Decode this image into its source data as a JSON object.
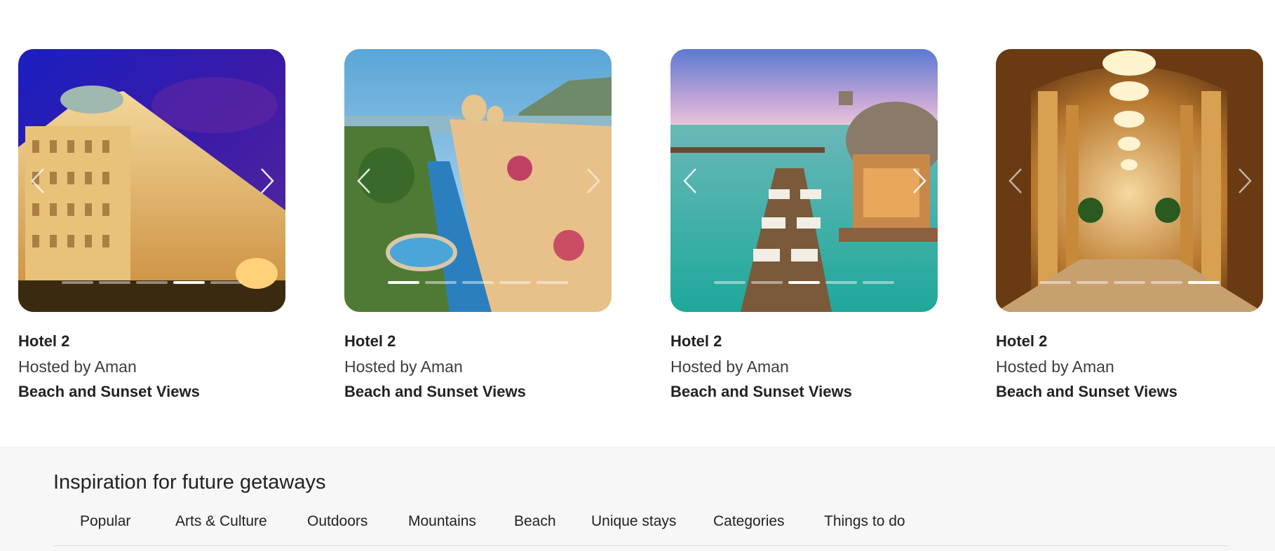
{
  "listings": [
    {
      "title": "Hotel 2",
      "host": "Hosted by Aman",
      "feature": "Beach and Sunset Views",
      "photo": "palace-hotel-night",
      "dots": 5,
      "active_dot": 3
    },
    {
      "title": "Hotel 2",
      "host": "Hosted by Aman",
      "feature": "Beach and Sunset Views",
      "photo": "lake-palace-pool",
      "dots": 5,
      "active_dot": 0
    },
    {
      "title": "Hotel 2",
      "host": "Hosted by Aman",
      "feature": "Beach and Sunset Views",
      "photo": "overwater-villa",
      "dots": 5,
      "active_dot": 2
    },
    {
      "title": "Hotel 2",
      "host": "Hosted by Aman",
      "feature": "Beach and Sunset Views",
      "photo": "chandelier-lobby",
      "dots": 5,
      "active_dot": 4
    }
  ],
  "icons": {
    "prev": "chevron-left-icon",
    "next": "chevron-right-icon"
  },
  "inspiration": {
    "title": "Inspiration for future getaways",
    "tabs": [
      "Popular",
      "Arts & Culture",
      "Outdoors",
      "Mountains",
      "Beach",
      "Unique stays",
      "Categories",
      "Things to do"
    ]
  },
  "colors": {
    "section_bg": "#f7f7f7",
    "text": "#222222",
    "divider": "#dddddd"
  }
}
